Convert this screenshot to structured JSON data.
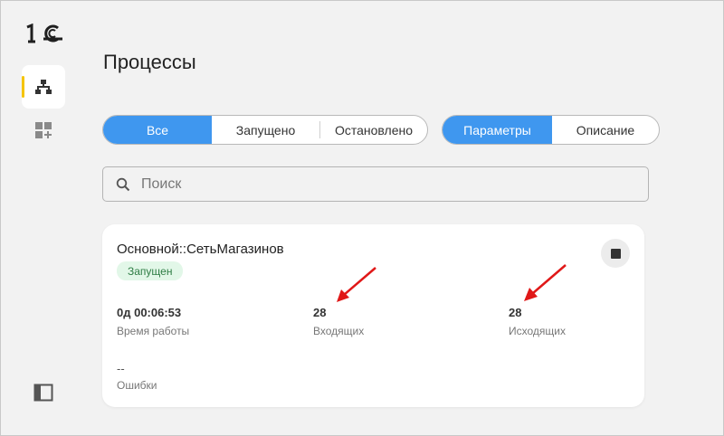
{
  "sidebar": {
    "logo": "1С",
    "items": [
      {
        "name": "processes",
        "icon": "hierarchy-icon",
        "active": true
      },
      {
        "name": "add",
        "icon": "add-widget-icon",
        "active": false
      }
    ],
    "bottom_icon": "panel-toggle-icon",
    "accent_color": "#f5c400"
  },
  "page": {
    "title": "Процессы"
  },
  "filters": {
    "status": [
      "Все",
      "Запущено",
      "Остановлено"
    ],
    "status_selected": "Все",
    "view": [
      "Параметры",
      "Описание"
    ],
    "view_selected": "Параметры",
    "accent_color": "#3f97ef"
  },
  "search": {
    "placeholder": "Поиск",
    "value": ""
  },
  "process": {
    "title": "Основной::СетьМагазинов",
    "status": "Запущен",
    "uptime_value": "0д 00:06:53",
    "uptime_label": "Время работы",
    "incoming_value": "28",
    "incoming_label": "Входящих",
    "outgoing_value": "28",
    "outgoing_label": "Исходящих",
    "errors_value": "--",
    "errors_label": "Ошибки"
  }
}
